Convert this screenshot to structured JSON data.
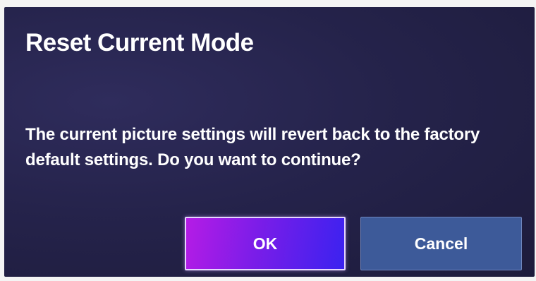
{
  "dialog": {
    "title": "Reset Current Mode",
    "message": "The current picture settings will revert back to the factory default settings. Do you want to continue?",
    "buttons": {
      "ok_label": "OK",
      "cancel_label": "Cancel"
    }
  },
  "colors": {
    "dialog_background": "#25234b",
    "ok_gradient_start": "#b51ce6",
    "ok_gradient_end": "#3b22f0",
    "cancel_background": "#3d5a99",
    "text": "#ffffff"
  }
}
